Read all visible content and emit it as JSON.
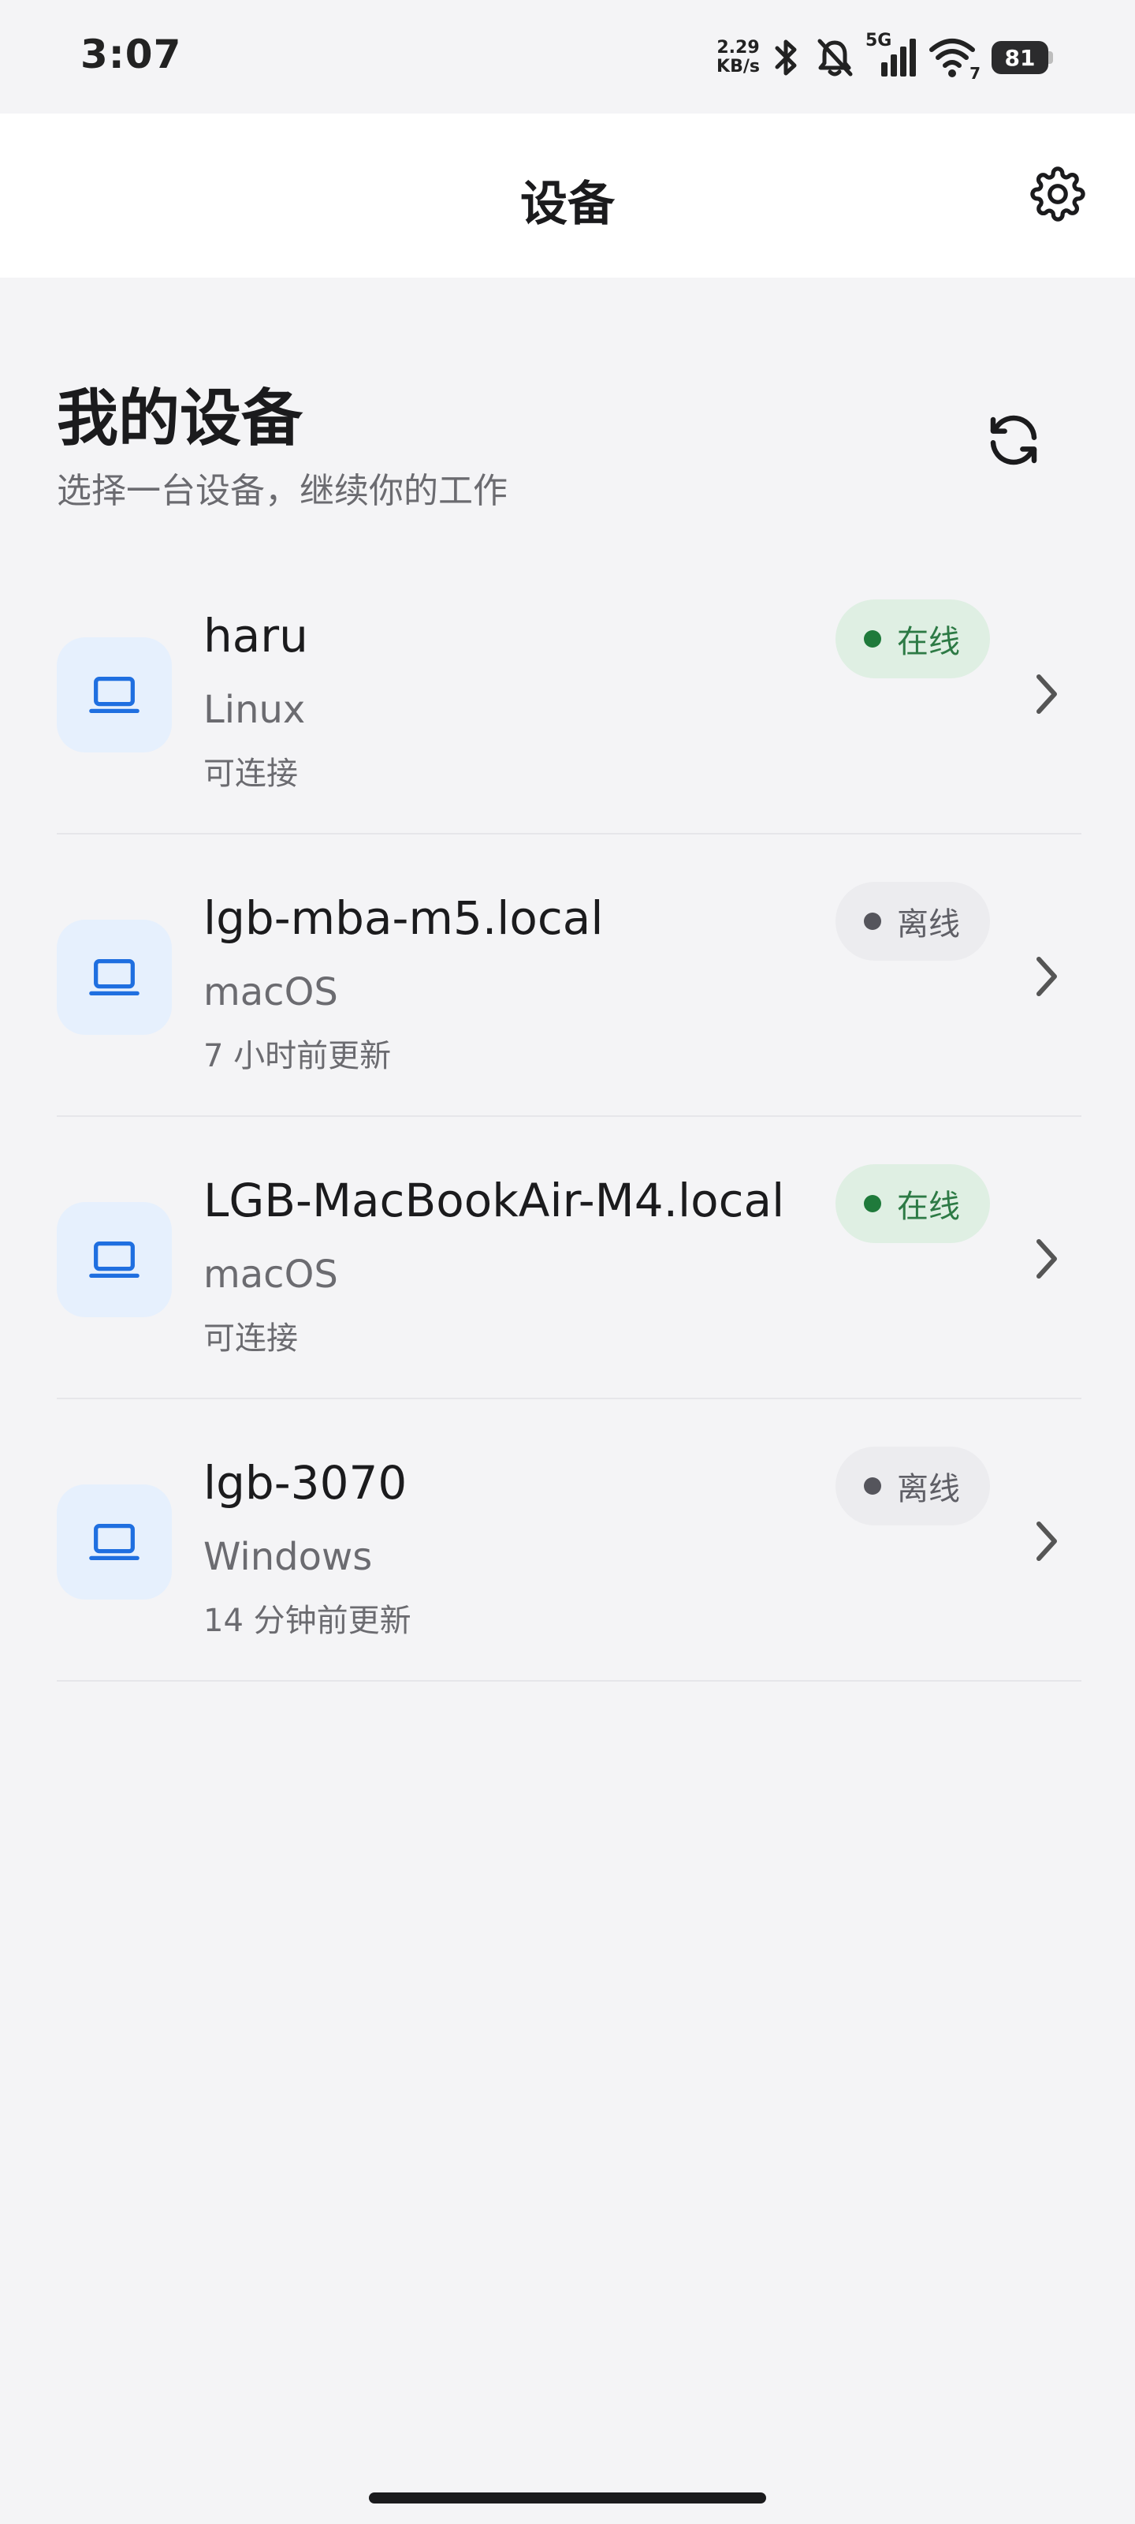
{
  "status_bar": {
    "time": "3:07",
    "net_speed_value": "2.29",
    "net_speed_unit": "KB/s",
    "network_label": "5G",
    "wifi_badge": "7",
    "battery": "81"
  },
  "app_bar": {
    "title": "设备",
    "settings_icon": "gear-icon"
  },
  "section": {
    "title": "我的设备",
    "subtitle": "选择一台设备，继续你的工作",
    "refresh_icon": "refresh-icon"
  },
  "devices": [
    {
      "name": "haru",
      "os": "Linux",
      "detail": "可连接",
      "status": "在线",
      "status_type": "online"
    },
    {
      "name": "lgb-mba-m5.local",
      "os": "macOS",
      "detail": "7 小时前更新",
      "status": "离线",
      "status_type": "offline"
    },
    {
      "name": "LGB-MacBookAir-M4.local",
      "os": "macOS",
      "detail": "可连接",
      "status": "在线",
      "status_type": "online"
    },
    {
      "name": "lgb-3070",
      "os": "Windows",
      "detail": "14 分钟前更新",
      "status": "离线",
      "status_type": "offline"
    }
  ],
  "colors": {
    "background": "#f4f4f6",
    "accent": "#1f6fe0",
    "online": "#2d7a45",
    "offline": "#5f5f66"
  }
}
